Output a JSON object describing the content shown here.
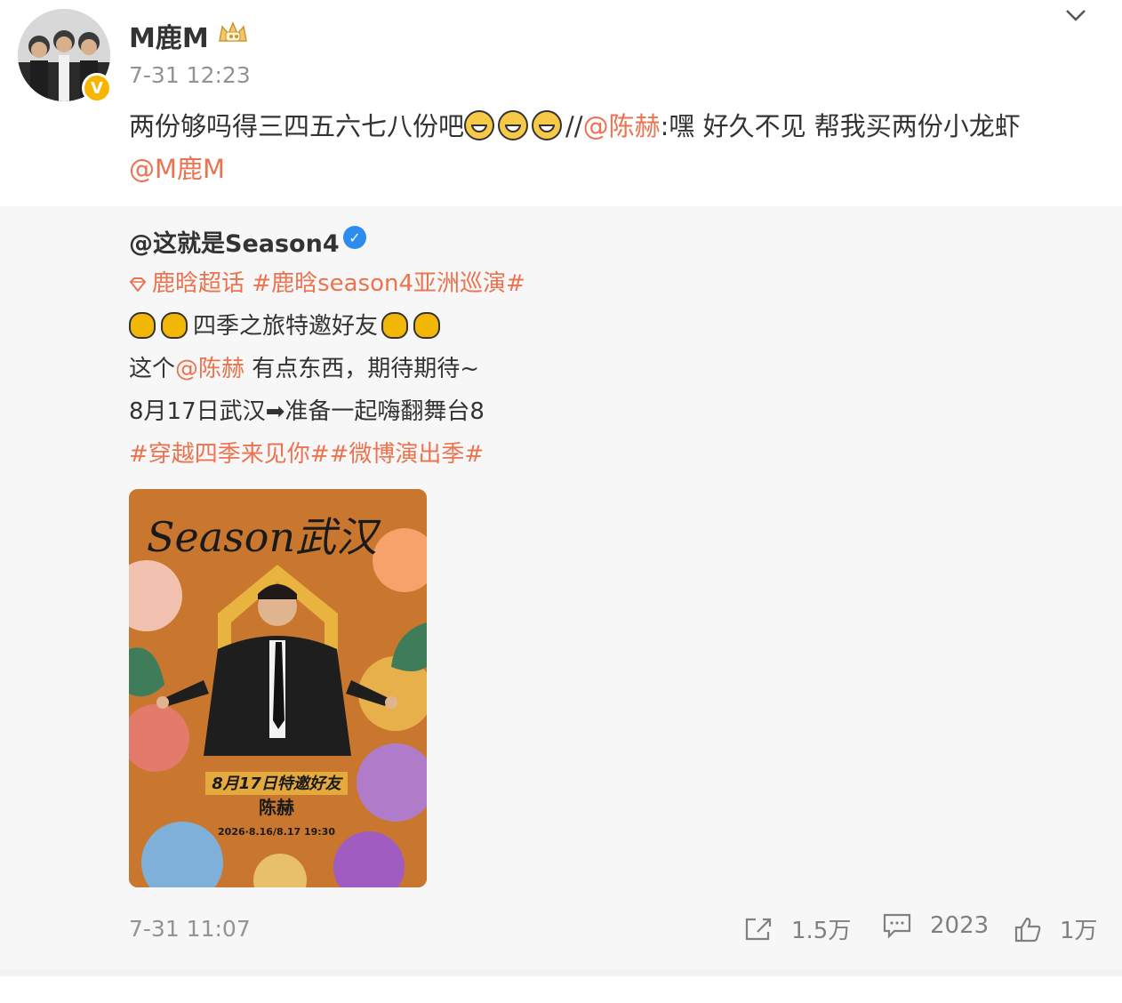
{
  "post": {
    "author": "M鹿M",
    "time": "7-31 12:23",
    "text_main": "两份够吗得三四五六七八份吧",
    "text_repost_prefix": "//",
    "mention_1": "@陈赫",
    "text_after_mention": ":嘿 好久不见 帮我买两份小龙虾",
    "mention_2": "@M鹿M",
    "emoji_name": "grin-emoji"
  },
  "repost": {
    "author": "@这就是Season4",
    "topics_line": {
      "supertopic": "鹿晗超话",
      "hashtag": "#鹿晗season4亚洲巡演#"
    },
    "line2": "四季之旅特邀好友",
    "line3_prefix": "这个",
    "line3_mention": "@陈赫",
    "line3_suffix": " 有点东西，期待期待~",
    "line4": "8月17日武汉➡准备一起嗨翻舞台8",
    "line5": "#穿越四季来见你##微博演出季#",
    "poster": {
      "title": "Season武汉",
      "subtitle": "8月17日特邀好友",
      "guest": "陈赫",
      "date": "2026·8.16/8.17 19:30"
    },
    "time": "7-31 11:07",
    "actions": {
      "share": "1.5万",
      "comment": "2023",
      "like": "1万"
    }
  },
  "colors": {
    "link": "#eb7350",
    "text": "#333333",
    "muted": "#939393",
    "repost_bg": "#f7f7f7"
  }
}
